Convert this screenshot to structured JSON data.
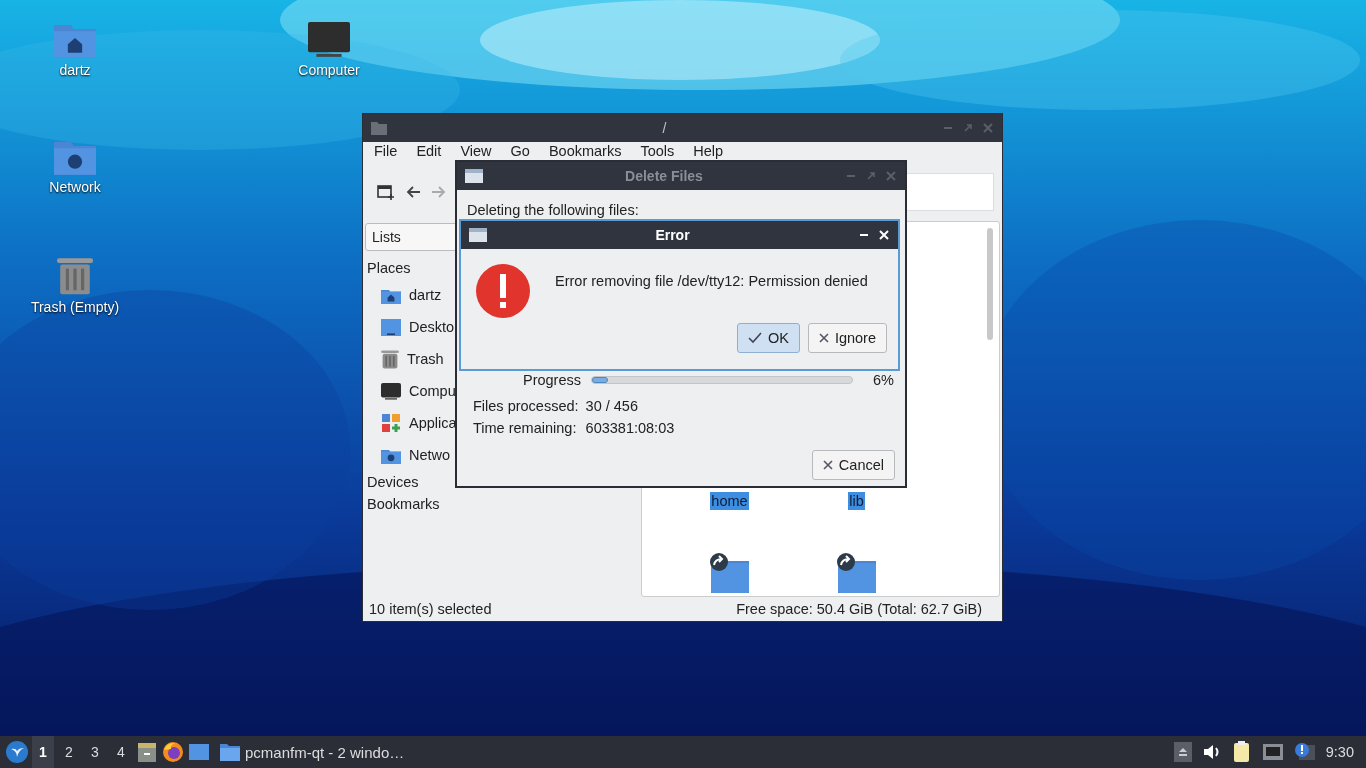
{
  "desktop_icons": [
    {
      "label": "dartz",
      "kind": "home"
    },
    {
      "label": "Computer",
      "kind": "computer"
    },
    {
      "label": "Network",
      "kind": "network"
    },
    {
      "label": "Trash (Empty)",
      "kind": "trash"
    }
  ],
  "file_manager": {
    "title": "/",
    "menu": [
      "File",
      "Edit",
      "View",
      "Go",
      "Bookmarks",
      "Tools",
      "Help"
    ],
    "side_panel": {
      "selector": "Lists",
      "sections": [
        {
          "label": "Places",
          "items": [
            {
              "label": "dartz",
              "kind": "home"
            },
            {
              "label": "Deskto",
              "kind": "desktop"
            },
            {
              "label": "Trash",
              "kind": "trash"
            },
            {
              "label": "Compu",
              "kind": "computer"
            },
            {
              "label": "Applica",
              "kind": "applications"
            },
            {
              "label": "Netwo",
              "kind": "network"
            }
          ]
        },
        {
          "label": "Devices"
        },
        {
          "label": "Bookmarks"
        }
      ]
    },
    "files": [
      {
        "label": "home",
        "selected": true
      },
      {
        "label": "lib",
        "selected": true
      }
    ],
    "next_row": [
      {
        "kind": "link-folder"
      },
      {
        "kind": "link-folder"
      }
    ],
    "status_bar": {
      "selection": "10 item(s) selected",
      "free_space": "Free space: 50.4 GiB (Total: 62.7 GiB)"
    }
  },
  "delete_dialog": {
    "title": "Delete Files",
    "active": false,
    "heading": "Deleting the following files:",
    "progress": {
      "label": "Progress",
      "level": 0.06,
      "reading": "6%"
    },
    "details": [
      {
        "label": "Files processed:",
        "value": "30 / 456"
      },
      {
        "label": "Time remaining:",
        "value": "603381:08:03"
      }
    ],
    "buttons": [
      {
        "label": "Cancel",
        "kind": "cancel",
        "default": false
      }
    ]
  },
  "error_dialog": {
    "title": "Error",
    "active": true,
    "message": "Error removing file /dev/tty12: Permission denied",
    "buttons": [
      {
        "label": "OK",
        "kind": "ok",
        "default": true
      },
      {
        "label": "Ignore",
        "kind": "ignore",
        "default": false
      }
    ]
  },
  "taskbar": {
    "workspaces": [
      {
        "label": "1",
        "selected": true
      },
      {
        "label": "2",
        "selected": false
      },
      {
        "label": "3",
        "selected": false
      },
      {
        "label": "4",
        "selected": false
      }
    ],
    "launchers": [
      {
        "kind": "files"
      },
      {
        "kind": "browser"
      },
      {
        "kind": "desktop"
      }
    ],
    "tasks": [
      {
        "label": "pcmanfm-qt - 2 windo…"
      }
    ],
    "tray": [
      {
        "kind": "eject"
      },
      {
        "kind": "volume"
      },
      {
        "kind": "clipboard"
      },
      {
        "kind": "network"
      },
      {
        "kind": "notification"
      }
    ],
    "clock": "9:30"
  }
}
